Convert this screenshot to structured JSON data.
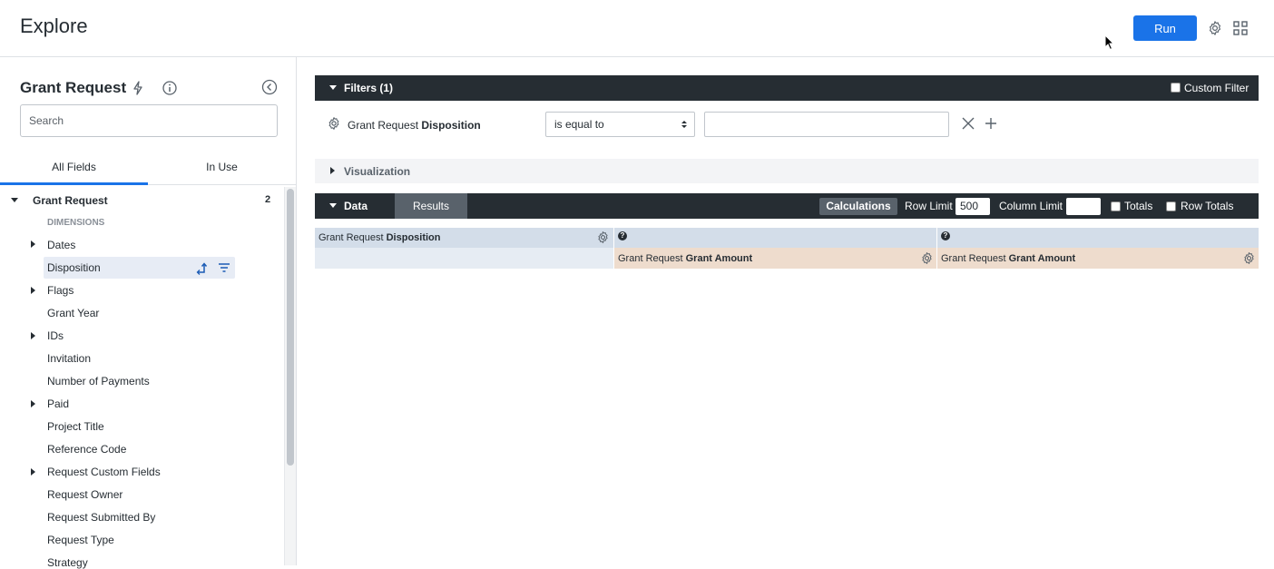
{
  "header": {
    "title": "Explore",
    "run_label": "Run",
    "icons": [
      "gear-icon",
      "grid-icon"
    ]
  },
  "sidebar": {
    "title": "Grant Request",
    "search_placeholder": "Search",
    "tabs": [
      {
        "label": "All Fields"
      },
      {
        "label": "In Use"
      }
    ],
    "view_group": {
      "label": "Grant Request",
      "count": "2"
    },
    "section_label": "DIMENSIONS",
    "fields": [
      {
        "label": "Dates"
      },
      {
        "label": "Disposition"
      },
      {
        "label": "Flags"
      },
      {
        "label": "Grant Year"
      },
      {
        "label": "IDs"
      },
      {
        "label": "Invitation"
      },
      {
        "label": "Number of Payments"
      },
      {
        "label": "Paid"
      },
      {
        "label": "Project Title"
      },
      {
        "label": "Reference Code"
      },
      {
        "label": "Request Custom Fields"
      },
      {
        "label": "Request Owner"
      },
      {
        "label": "Request Submitted By"
      },
      {
        "label": "Request Type"
      },
      {
        "label": "Strategy"
      }
    ]
  },
  "filters": {
    "bar_label": "Filters (1)",
    "custom_filter_label": "Custom Filter",
    "field_view": "Grant Request",
    "field_name": "Disposition",
    "operator": "is equal to",
    "value": ""
  },
  "visualization": {
    "label": "Visualization"
  },
  "data": {
    "label": "Data",
    "results_tab": "Results",
    "calculations_label": "Calculations",
    "row_limit_label": "Row Limit",
    "row_limit_value": "500",
    "column_limit_label": "Column Limit",
    "column_limit_value": "",
    "totals_label": "Totals",
    "row_totals_label": "Row Totals",
    "dimension_header": {
      "view": "Grant Request",
      "name": "Disposition"
    },
    "pivot_columns": [
      {
        "view": "Grant Request",
        "name": "Grant Amount"
      },
      {
        "view": "Grant Request",
        "name": "Grant Amount"
      }
    ],
    "help_glyph": "?"
  },
  "colors": {
    "accent": "#1a73e8",
    "dark_bar": "#262d33",
    "dimension_bg": "#d3dde9",
    "measure_bg": "#eedccd"
  }
}
